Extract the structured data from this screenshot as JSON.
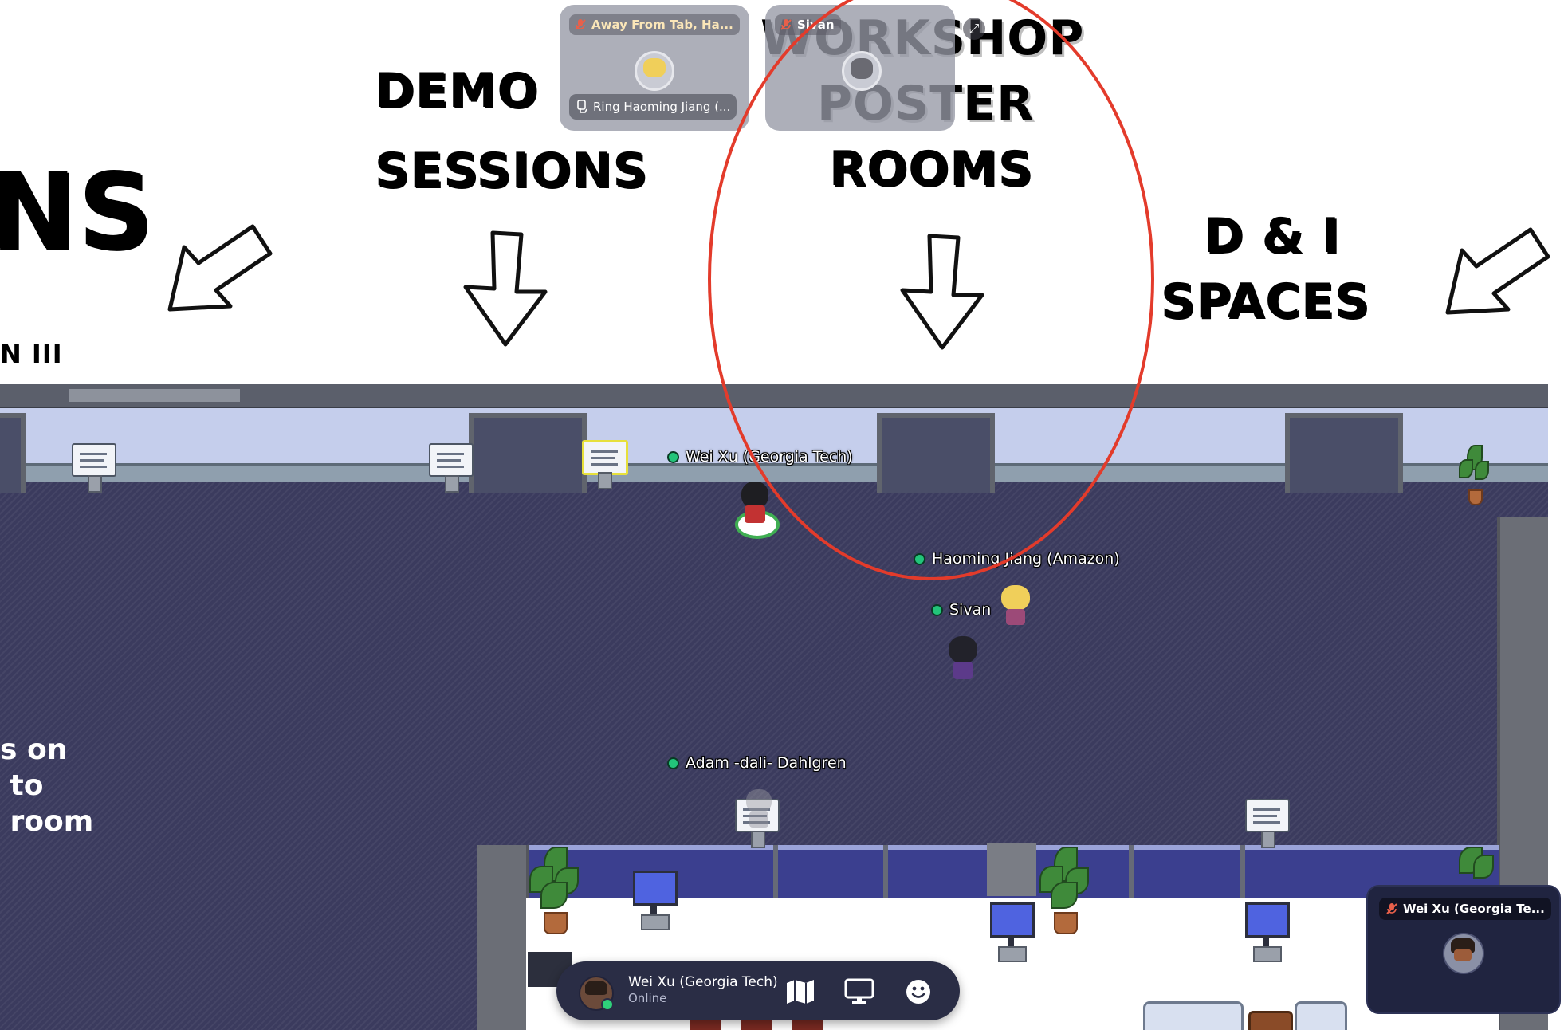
{
  "signage": {
    "left_partial": "NS",
    "left_sub": "N III",
    "demo_line1": "DEMO",
    "demo_line2": "SESSIONS",
    "workshop_line1": "WORKSHOP",
    "workshop_line2": "POSTER",
    "workshop_line3": "ROOMS",
    "di_line1": "D & I",
    "di_line2": "SPACES",
    "side_text": "s on\n to\n room"
  },
  "players": [
    {
      "name": "Wei Xu (Georgia Tech)"
    },
    {
      "name": "Haoming Jiang (Amazon)"
    },
    {
      "name": "Sivan"
    },
    {
      "name": "Adam -dali- Dahlgren"
    }
  ],
  "video_tiles": [
    {
      "status": "Away From Tab, Ha...",
      "name": "Ring Haoming Jiang (..."
    },
    {
      "status": "Sivan"
    }
  ],
  "bottom_bar": {
    "user_name": "Wei Xu (Georgia Tech)",
    "user_status": "Online",
    "map_button": "map-icon",
    "screen_share_button": "monitor-icon",
    "emote_button": "smiley-icon"
  },
  "self_video": {
    "label": "Wei Xu (Georgia Te..."
  },
  "colors": {
    "annotation": "#e33b2b",
    "floor": "#3b3b5e",
    "online_dot": "#22c47a"
  }
}
